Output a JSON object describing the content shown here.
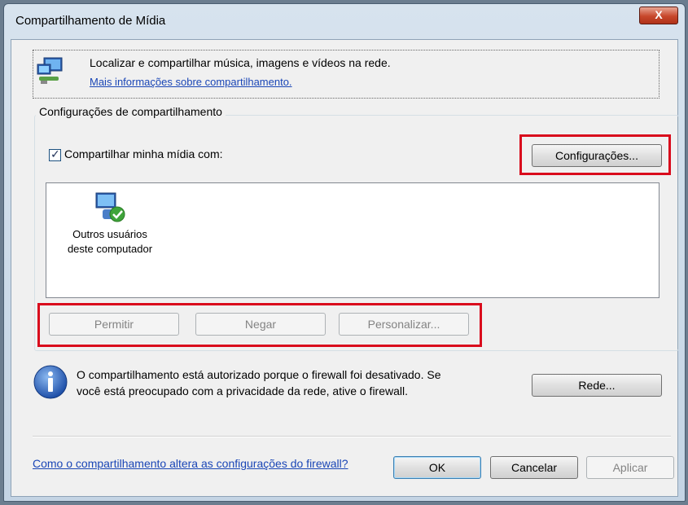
{
  "window": {
    "title": "Compartilhamento de Mídia",
    "close_label": "X"
  },
  "header": {
    "description": "Localizar e compartilhar música, imagens e vídeos na rede.",
    "link": "Mais informações sobre compartilhamento."
  },
  "sharing_settings": {
    "group_label": "Configurações de compartilhamento",
    "share_checkbox_label": "Compartilhar minha mídia com:",
    "share_checked": true,
    "settings_button": "Configurações...",
    "devices": [
      {
        "label_line1": "Outros usuários",
        "label_line2": "deste computador",
        "icon": "users-computer-icon"
      }
    ],
    "buttons": {
      "allow": "Permitir",
      "deny": "Negar",
      "customize": "Personalizar..."
    }
  },
  "info": {
    "icon": "info-icon",
    "line1": "O compartilhamento está autorizado porque o firewall foi desativado. Se",
    "line2": "você está preocupado com a privacidade da rede, ative o firewall.",
    "network_button": "Rede..."
  },
  "footer": {
    "firewall_link": "Como o compartilhamento altera as configurações do firewall?",
    "ok": "OK",
    "cancel": "Cancelar",
    "apply": "Aplicar"
  },
  "colors": {
    "highlight": "#d90a1c",
    "link": "#1a46b6"
  }
}
